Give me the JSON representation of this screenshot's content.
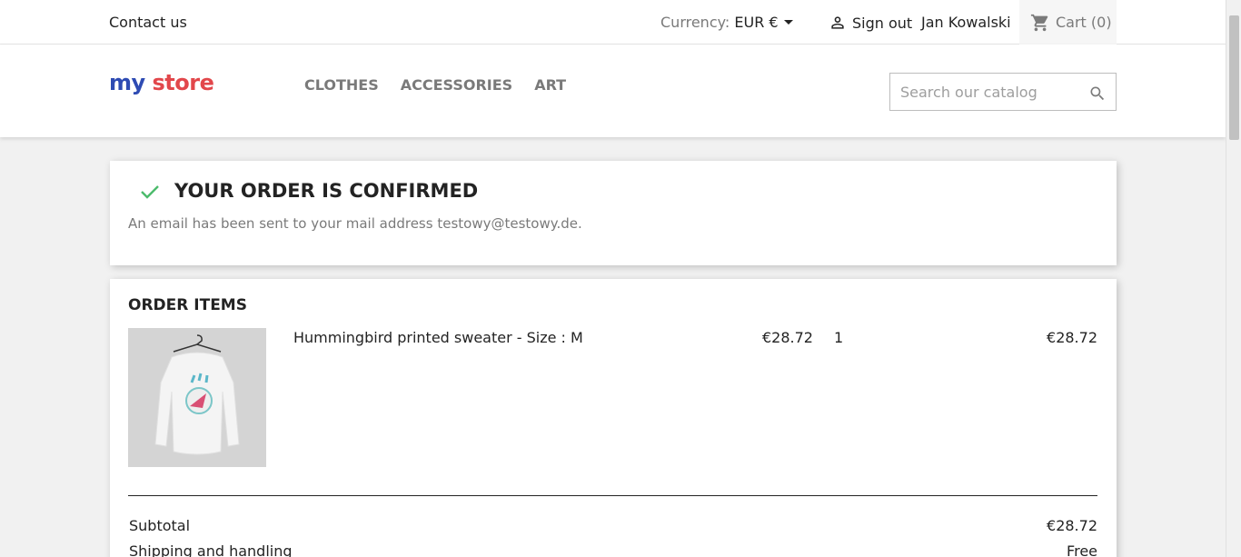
{
  "topbar": {
    "contact": "Contact us",
    "currency_label": "Currency:",
    "currency_value": "EUR €",
    "sign_out": "Sign out",
    "user_name": "Jan Kowalski",
    "cart": "Cart (0)"
  },
  "header": {
    "logo_word1": "my",
    "logo_word2": "store",
    "nav": [
      "CLOTHES",
      "ACCESSORIES",
      "ART"
    ],
    "search_placeholder": "Search our catalog"
  },
  "confirmation": {
    "title": "YOUR ORDER IS CONFIRMED",
    "message": "An email has been sent to your mail address testowy@testowy.de."
  },
  "order": {
    "title": "ORDER ITEMS",
    "items": [
      {
        "name": "Hummingbird printed sweater - Size : M",
        "unit_price": "€28.72",
        "quantity": "1",
        "total": "€28.72"
      }
    ],
    "summary": [
      {
        "label": "Subtotal",
        "value": "€28.72"
      },
      {
        "label": "Shipping and handling",
        "value": "Free"
      }
    ]
  },
  "colors": {
    "accent_green": "#4cbb6c",
    "text_dark": "#232323",
    "text_muted": "#7a7a7a",
    "page_bg": "#f1f1f1"
  }
}
